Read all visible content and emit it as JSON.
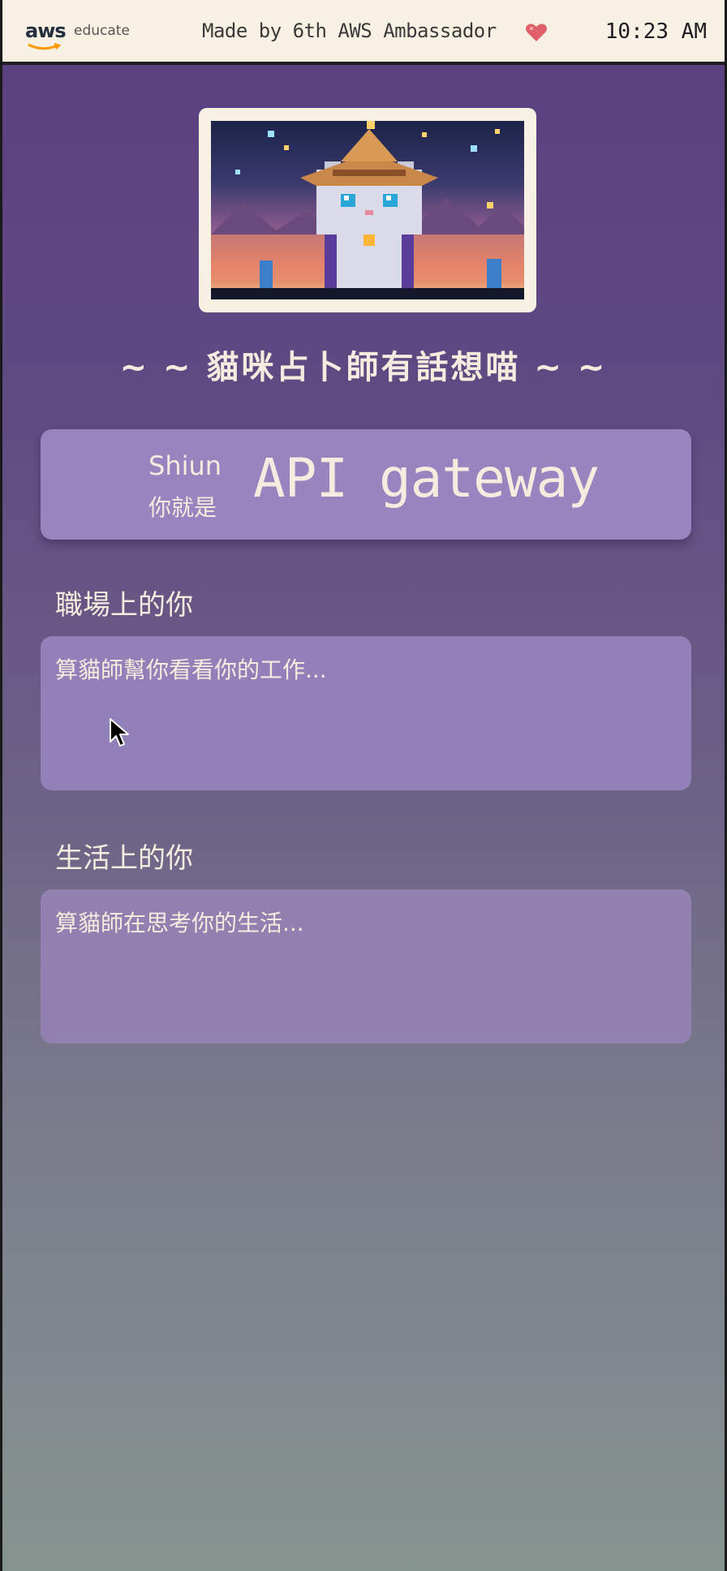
{
  "header": {
    "logo_text": "aws",
    "logo_suffix": "educate",
    "credit": "Made by 6th AWS Ambassador",
    "heart_icon": "heart-icon",
    "time": "10:23 AM"
  },
  "hero": {
    "image": "pixel-art-cat-fortune-teller"
  },
  "title": "~ ~ 貓咪占卜師有話想喵 ~ ~",
  "result": {
    "name": "Shiun",
    "prefix": "你就是",
    "value": "API gateway"
  },
  "sections": [
    {
      "label": "職場上的你",
      "text": "算貓師幫你看看你的工作..."
    },
    {
      "label": "生活上的你",
      "text": "算貓師在思考你的生活..."
    }
  ],
  "colors": {
    "accent": "#9a84c0",
    "text": "#f4ecdf",
    "topbar": "#f6f1e2",
    "heart": "#e0606a"
  }
}
